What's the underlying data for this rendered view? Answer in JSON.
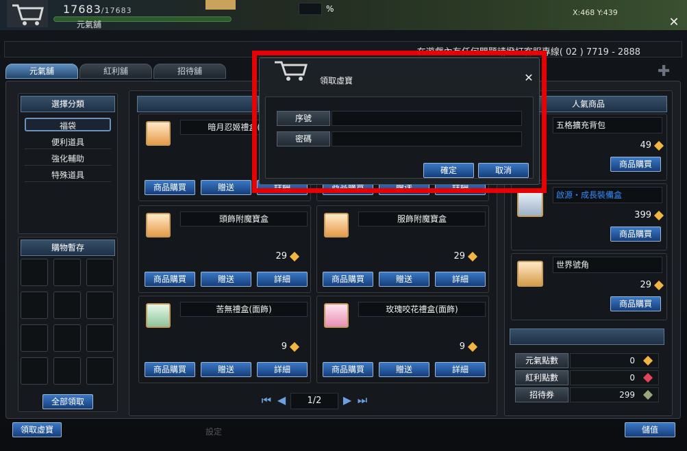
{
  "hud": {
    "hp_value": "17683",
    "hp_max": "17683",
    "shop_title": "元氣舖",
    "percent_symbol": "%",
    "coord_text": "X:468 Y:439"
  },
  "notice": {
    "text": "在遊戲內有任何問題請撥打客服專線( 02 ) 7719 - 2888"
  },
  "tabs": [
    {
      "label": "元氣舖",
      "active": true
    },
    {
      "label": "紅利舖",
      "active": false
    },
    {
      "label": "招待舖",
      "active": false
    }
  ],
  "categories": {
    "header": "選擇分類",
    "items": [
      "福袋",
      "便利道具",
      "強化輔助",
      "特殊道具"
    ],
    "selected": "福袋"
  },
  "cart_storage": {
    "header": "購物暫存",
    "claim_all_label": "全部領取"
  },
  "products": [
    {
      "name": "暗月忍姬禮盒(頭飾)",
      "price": "",
      "buy_label": "商品購買",
      "gift_label": "贈送",
      "detail_label": "詳細"
    },
    {
      "name": "",
      "price": "",
      "buy_label": "商品購買",
      "gift_label": "贈送",
      "detail_label": "詳細"
    },
    {
      "name": "頭飾附魔寶盒",
      "price": "29",
      "buy_label": "商品購買",
      "gift_label": "贈送",
      "detail_label": "詳細"
    },
    {
      "name": "服飾附魔寶盒",
      "price": "29",
      "buy_label": "商品購買",
      "gift_label": "贈送",
      "detail_label": "詳細"
    },
    {
      "name": "苦無禮盒(面飾)",
      "price": "9",
      "buy_label": "商品購買",
      "gift_label": "贈送",
      "detail_label": "詳細"
    },
    {
      "name": "玫瑰咬花禮盒(面飾)",
      "price": "9",
      "buy_label": "商品購買",
      "gift_label": "贈送",
      "detail_label": "詳細"
    }
  ],
  "pager": {
    "page": "1/2"
  },
  "popular": {
    "header": "人氣商品",
    "items": [
      {
        "name": "五格擴充背包",
        "price": "49",
        "buy_label": "商品購買",
        "highlight": false
      },
      {
        "name": "啟源・成長裝備盒",
        "price": "399",
        "buy_label": "商品購買",
        "highlight": true
      },
      {
        "name": "世界號角",
        "price": "29",
        "buy_label": "商品購買",
        "highlight": false
      }
    ]
  },
  "points": {
    "rows": [
      {
        "label": "元氣點數",
        "value": "0",
        "gem": "gold"
      },
      {
        "label": "紅利點數",
        "value": "0",
        "gem": "red"
      },
      {
        "label": "招待券",
        "value": "299",
        "gem": "ticket"
      }
    ]
  },
  "footer": {
    "claim_virtual_label": "領取虛寶",
    "topup_label": "儲值",
    "settings_label": "設定"
  },
  "dialog": {
    "title": "領取虛寶",
    "serial_label": "序號",
    "serial_value": "",
    "password_label": "密碼",
    "password_value": "",
    "confirm_label": "確定",
    "cancel_label": "取消"
  },
  "colors": {
    "highlight_text": "#2f8dff",
    "annotation_box": "#e60000",
    "button_blue": "#1d4f94"
  }
}
